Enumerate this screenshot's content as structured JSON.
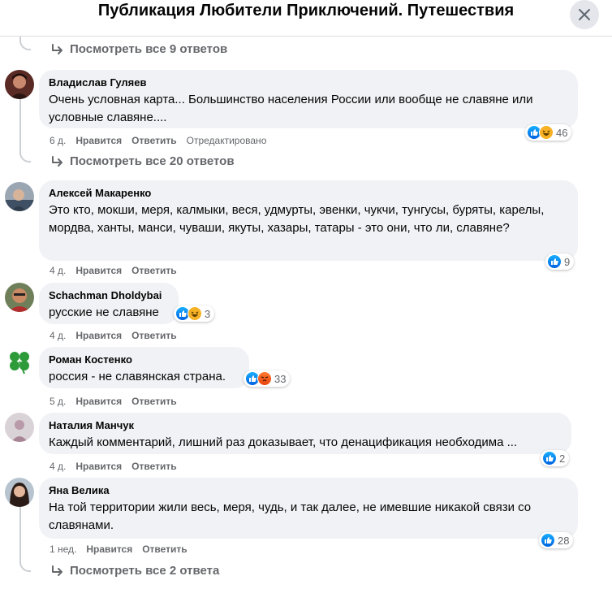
{
  "header": {
    "title": "Публикация Любители Приключений. Путешествия"
  },
  "colors": {
    "like": "#0866ff",
    "haha": "#f7b125",
    "angry": "#e9430f",
    "bubble": "#f0f2f5"
  },
  "replies_links": [
    {
      "label": "Посмотреть все 9 ответов"
    },
    {
      "label": "Посмотреть все 20 ответов"
    },
    {
      "label": "Посмотреть все 2 ответа"
    }
  ],
  "actions": {
    "like": "Нравится",
    "reply": "Ответить",
    "edited": "Отредактировано"
  },
  "comments": [
    {
      "author": "Владислав Гуляев",
      "text": "Очень условная карта... Большинство населения России или вообще не славяне или условные славяне....",
      "time": "6 д.",
      "edited": true,
      "reactions": [
        "like",
        "haha"
      ],
      "count": "46"
    },
    {
      "author": "Алексей Макаренко",
      "text": "Это кто, мокши, меря, калмыки, веся, удмурты, эвенки, чукчи, тунгусы, буряты, карелы, мордва, ханты, манси, чуваши, якуты, хазары, татары - это они, что ли, славяне?",
      "time": "4 д.",
      "edited": false,
      "reactions": [
        "like"
      ],
      "count": "9"
    },
    {
      "author": "Schachman Dholdybai",
      "text": "русские не славяне",
      "time": "4 д.",
      "edited": false,
      "reactions": [
        "like",
        "haha"
      ],
      "count": "3"
    },
    {
      "author": "Роман Костенко",
      "text": "россия - не славянская страна.",
      "time": "5 д.",
      "edited": false,
      "reactions": [
        "like",
        "angry"
      ],
      "count": "33"
    },
    {
      "author": "Наталия Манчук",
      "text": "Каждый комментарий, лишний раз доказывает, что денацификация необходима ...",
      "time": "4 д.",
      "edited": false,
      "reactions": [
        "like"
      ],
      "count": "2"
    },
    {
      "author": "Яна Велика",
      "text": "На той территории жили весь, меря, чудь, и так далее, не имевшие никакой связи со славянами.",
      "time": "1 нед.",
      "edited": false,
      "reactions": [
        "like"
      ],
      "count": "28"
    }
  ],
  "icons": {
    "close": "close-icon",
    "reply_arrow": "reply-arrow-icon",
    "like": "like-icon",
    "haha": "haha-icon",
    "angry": "angry-icon"
  }
}
